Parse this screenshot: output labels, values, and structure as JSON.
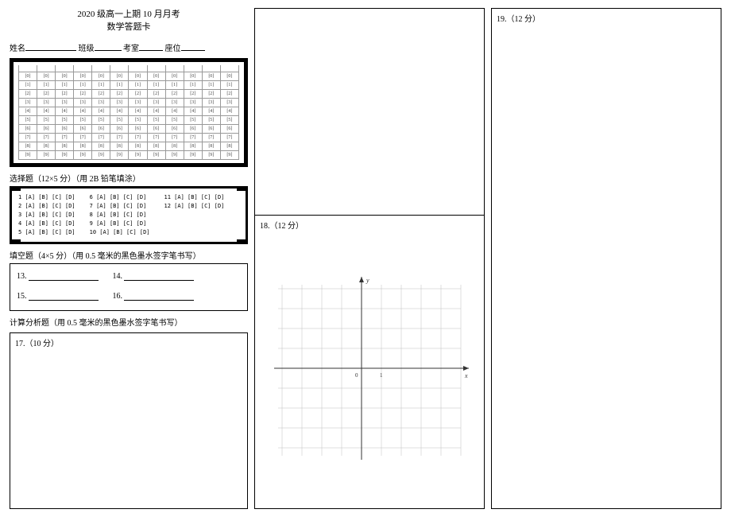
{
  "header": {
    "title1": "2020 级高一上期 10 月月考",
    "title2": "数学答题卡"
  },
  "name_row": {
    "name_label": "姓名",
    "class_label": "班级",
    "room_label": "考室",
    "seat_label": "座位"
  },
  "omr": {
    "digits": [
      "[0]",
      "[1]",
      "[2]",
      "[3]",
      "[4]",
      "[5]",
      "[6]",
      "[7]",
      "[8]",
      "[9]"
    ],
    "columns": 12
  },
  "mc_section": {
    "label": "选择题（12×5 分）（用 2B 铅笔填涂）",
    "bubble": "[A] [B] [C] [D]",
    "groups": [
      {
        "nums": [
          "1",
          "2",
          "3",
          "4",
          "5"
        ]
      },
      {
        "nums": [
          "6",
          "7",
          "8",
          "9",
          "10"
        ]
      },
      {
        "nums": [
          "11",
          "12"
        ]
      }
    ]
  },
  "fill_section": {
    "label": "填空题（4×5 分）（用 0.5 毫米的黑色墨水签字笔书写）",
    "items": [
      {
        "num": "13."
      },
      {
        "num": "14."
      },
      {
        "num": "15."
      },
      {
        "num": "16."
      }
    ]
  },
  "analysis_section": {
    "label": "计算分析题（用 0.5 毫米的黑色墨水签字笔书写）",
    "q17": "17.（10 分）"
  },
  "mid": {
    "q18": "18.（12 分）",
    "graph": {
      "xlabel": "x",
      "ylabel": "y",
      "origin": "0",
      "xtick": "1"
    }
  },
  "right": {
    "q19": "19.（12 分）"
  },
  "chart_data": {
    "type": "scatter",
    "title": "",
    "xlabel": "x",
    "ylabel": "y",
    "x": [],
    "y": [],
    "xlim": [
      -4,
      5
    ],
    "ylim": [
      -5,
      5
    ],
    "notes": "Blank coordinate grid with labeled axes; origin 0 and x-tick 1 shown; no data points plotted."
  }
}
